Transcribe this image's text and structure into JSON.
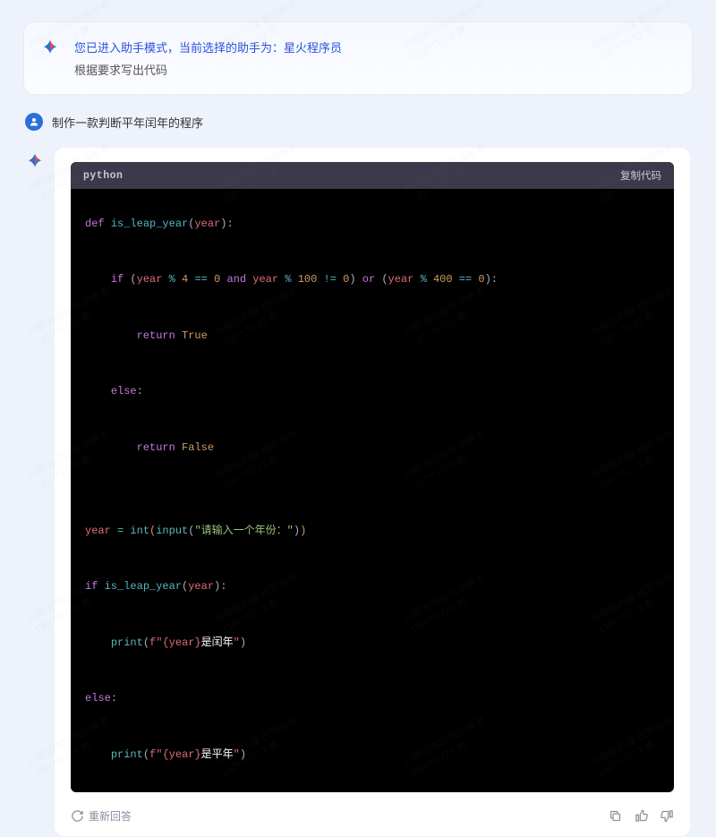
{
  "intro": {
    "line1": "您已进入助手模式，当前选择的助手为：星火程序员",
    "line2": "根据要求写出代码"
  },
  "user_message": "制作一款判断平年闰年的程序",
  "code": {
    "language": "python",
    "copy_label": "复制代码",
    "tokens": [
      [
        {
          "t": "kw",
          "v": "def"
        },
        {
          "t": "sp",
          "v": " "
        },
        {
          "t": "fn",
          "v": "is_leap_year"
        },
        {
          "t": "punc",
          "v": "("
        },
        {
          "t": "var",
          "v": "year"
        },
        {
          "t": "punc",
          "v": "):"
        }
      ],
      [],
      [
        {
          "t": "sp",
          "v": "    "
        },
        {
          "t": "kw",
          "v": "if"
        },
        {
          "t": "sp",
          "v": " "
        },
        {
          "t": "punc",
          "v": "("
        },
        {
          "t": "var",
          "v": "year"
        },
        {
          "t": "sp",
          "v": " "
        },
        {
          "t": "op",
          "v": "%"
        },
        {
          "t": "sp",
          "v": " "
        },
        {
          "t": "num",
          "v": "4"
        },
        {
          "t": "sp",
          "v": " "
        },
        {
          "t": "op",
          "v": "=="
        },
        {
          "t": "sp",
          "v": " "
        },
        {
          "t": "num",
          "v": "0"
        },
        {
          "t": "sp",
          "v": " "
        },
        {
          "t": "kw",
          "v": "and"
        },
        {
          "t": "sp",
          "v": " "
        },
        {
          "t": "var",
          "v": "year"
        },
        {
          "t": "sp",
          "v": " "
        },
        {
          "t": "op",
          "v": "%"
        },
        {
          "t": "sp",
          "v": " "
        },
        {
          "t": "num",
          "v": "100"
        },
        {
          "t": "sp",
          "v": " "
        },
        {
          "t": "op",
          "v": "!="
        },
        {
          "t": "sp",
          "v": " "
        },
        {
          "t": "num",
          "v": "0"
        },
        {
          "t": "punc",
          "v": ")"
        },
        {
          "t": "sp",
          "v": " "
        },
        {
          "t": "kw",
          "v": "or"
        },
        {
          "t": "sp",
          "v": " "
        },
        {
          "t": "punc",
          "v": "("
        },
        {
          "t": "var",
          "v": "year"
        },
        {
          "t": "sp",
          "v": " "
        },
        {
          "t": "op",
          "v": "%"
        },
        {
          "t": "sp",
          "v": " "
        },
        {
          "t": "num",
          "v": "400"
        },
        {
          "t": "sp",
          "v": " "
        },
        {
          "t": "op",
          "v": "=="
        },
        {
          "t": "sp",
          "v": " "
        },
        {
          "t": "num",
          "v": "0"
        },
        {
          "t": "punc",
          "v": "):"
        }
      ],
      [],
      [
        {
          "t": "sp",
          "v": "        "
        },
        {
          "t": "kw",
          "v": "return"
        },
        {
          "t": "sp",
          "v": " "
        },
        {
          "t": "bool",
          "v": "True"
        }
      ],
      [],
      [
        {
          "t": "sp",
          "v": "    "
        },
        {
          "t": "kw",
          "v": "else"
        },
        {
          "t": "punc",
          "v": ":"
        }
      ],
      [],
      [
        {
          "t": "sp",
          "v": "        "
        },
        {
          "t": "kw",
          "v": "return"
        },
        {
          "t": "sp",
          "v": " "
        },
        {
          "t": "bool",
          "v": "False"
        }
      ],
      [],
      [],
      [
        {
          "t": "var",
          "v": "year"
        },
        {
          "t": "sp",
          "v": " "
        },
        {
          "t": "op",
          "v": "="
        },
        {
          "t": "sp",
          "v": " "
        },
        {
          "t": "fn",
          "v": "int"
        },
        {
          "t": "paren",
          "v": "("
        },
        {
          "t": "fn",
          "v": "input"
        },
        {
          "t": "punc",
          "v": "("
        },
        {
          "t": "str",
          "v": "\"请输入一个年份：\""
        },
        {
          "t": "punc",
          "v": ")"
        },
        {
          "t": "paren",
          "v": ")"
        }
      ],
      [],
      [
        {
          "t": "kw",
          "v": "if"
        },
        {
          "t": "sp",
          "v": " "
        },
        {
          "t": "fn",
          "v": "is_leap_year"
        },
        {
          "t": "punc",
          "v": "("
        },
        {
          "t": "var",
          "v": "year"
        },
        {
          "t": "punc",
          "v": "):"
        }
      ],
      [],
      [
        {
          "t": "sp",
          "v": "    "
        },
        {
          "t": "fn",
          "v": "print"
        },
        {
          "t": "punc",
          "v": "("
        },
        {
          "t": "fstr",
          "v": "f\""
        },
        {
          "t": "var",
          "v": "{year}"
        },
        {
          "t": "white",
          "v": "是闰年"
        },
        {
          "t": "fstr",
          "v": "\""
        },
        {
          "t": "punc",
          "v": ")"
        }
      ],
      [],
      [
        {
          "t": "kw",
          "v": "else"
        },
        {
          "t": "punc",
          "v": ":"
        }
      ],
      [],
      [
        {
          "t": "sp",
          "v": "    "
        },
        {
          "t": "fn",
          "v": "print"
        },
        {
          "t": "punc",
          "v": "("
        },
        {
          "t": "fstr",
          "v": "f\""
        },
        {
          "t": "var",
          "v": "{year}"
        },
        {
          "t": "white",
          "v": "是平年"
        },
        {
          "t": "fstr",
          "v": "\""
        },
        {
          "t": "punc",
          "v": ")"
        }
      ]
    ]
  },
  "footer": {
    "regenerate": "重新回答"
  },
  "watermark": {
    "line1": "AI输出内容 仅供参考",
    "line2": "130***3773 黄"
  }
}
